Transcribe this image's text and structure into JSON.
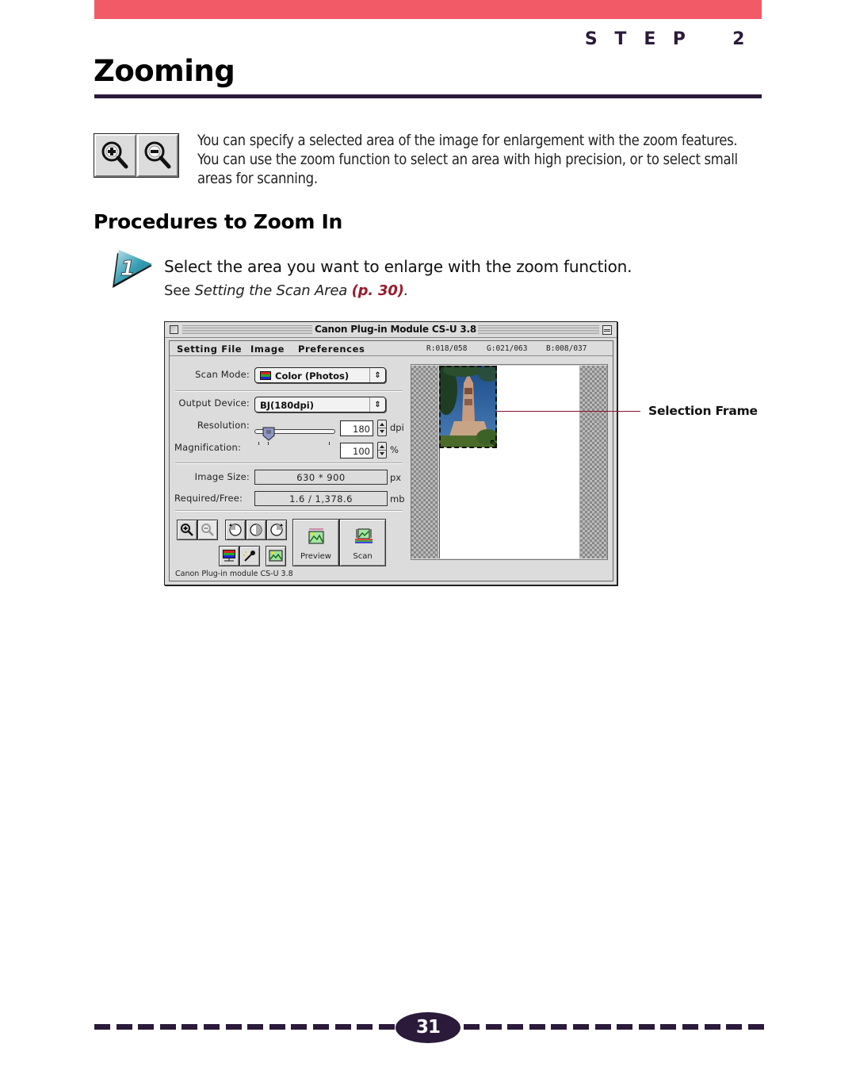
{
  "header": {
    "step_letters": [
      "S",
      "T",
      "E",
      "P",
      "2"
    ],
    "bar_color": "#f35a68",
    "accent_color": "#2b1a3a"
  },
  "page": {
    "title": "Zooming",
    "intro_text": "You can specify a selected area of the image for enlargement with the zoom features. You can use the zoom function to select an area with high precision, or to select small areas for scanning.",
    "intro_icons": [
      "zoom-in-icon",
      "zoom-out-icon"
    ],
    "section_heading": "Procedures to Zoom In",
    "step": {
      "number": "1",
      "instruction": "Select the area you want to enlarge with the zoom function.",
      "ref_prefix": "See ",
      "ref_title": "Setting the Scan Area",
      "ref_page": "(p. 30)",
      "ref_suffix": ".",
      "ref_color": "#9a1b2c"
    },
    "callout": {
      "label": "Selection Frame",
      "line_color": "#8a1030"
    },
    "page_number": "31"
  },
  "window": {
    "title": "Canon Plug-in Module CS-U 3.8",
    "menu": [
      "Setting File",
      "Image",
      "Preferences"
    ],
    "rgb": {
      "r": "R:018/058",
      "g": "G:021/063",
      "b": "B:008/037"
    },
    "scan_mode": {
      "label": "Scan Mode:",
      "value": "Color (Photos)"
    },
    "output_device": {
      "label": "Output Device:",
      "value": "BJ(180dpi)"
    },
    "resolution": {
      "label": "Resolution:",
      "value": "180",
      "unit": "dpi",
      "slider_fraction": 0.18
    },
    "magnification": {
      "label": "Magnification:",
      "value": "100",
      "unit": "%"
    },
    "image_size": {
      "label": "Image Size:",
      "value": "630 * 900",
      "unit": "px"
    },
    "required_free": {
      "label": "Required/Free:",
      "value": "1.6 / 1,378.6",
      "unit": "mb"
    },
    "buttons": {
      "preview": "Preview",
      "scan": "Scan"
    },
    "footer": "Canon Plug-in module CS-U 3.8"
  }
}
